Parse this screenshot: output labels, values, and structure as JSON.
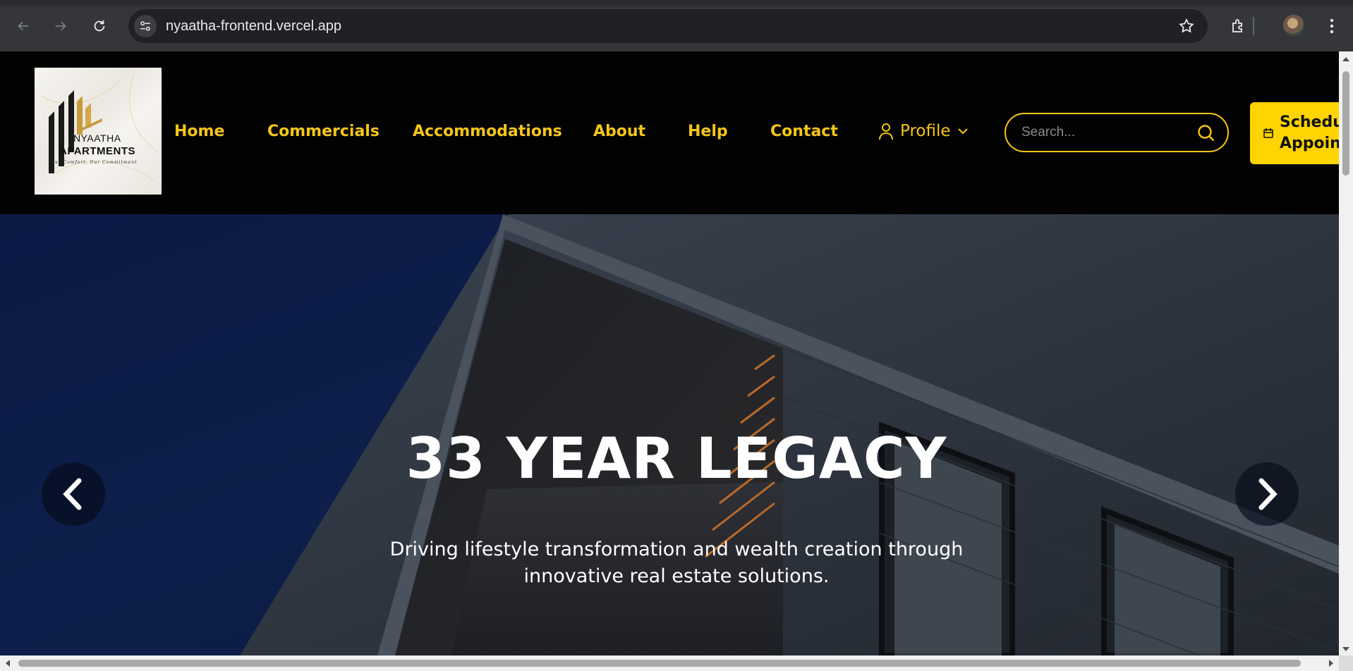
{
  "browser": {
    "url": "nyaatha-frontend.vercel.app",
    "icons": [
      "back-icon",
      "forward-icon",
      "reload-icon",
      "site-info-icon",
      "bookmark-star-icon",
      "extensions-icon",
      "profile-avatar",
      "more-menu-icon"
    ]
  },
  "logo": {
    "line1": "NYAATHA",
    "line2": "APARTMENTS",
    "tagline": "Your Comfort, Our Commitment"
  },
  "nav": {
    "home": "Home",
    "commercials": "Commercials",
    "accommodations": "Accommodations",
    "about": "About",
    "help": "Help",
    "contact": "Contact",
    "profile": "Profile"
  },
  "search": {
    "placeholder": "Search..."
  },
  "schedule": {
    "line1": "Schedu",
    "line2": "Appoin"
  },
  "hero": {
    "title": "33 YEAR LEGACY",
    "subtitle": "Driving lifestyle transformation and wealth creation through innovative real estate solutions."
  },
  "colors": {
    "accent": "#f5c518",
    "button": "#ffd400",
    "header_bg": "#020202",
    "hero_bg": "#0d1f4a"
  }
}
